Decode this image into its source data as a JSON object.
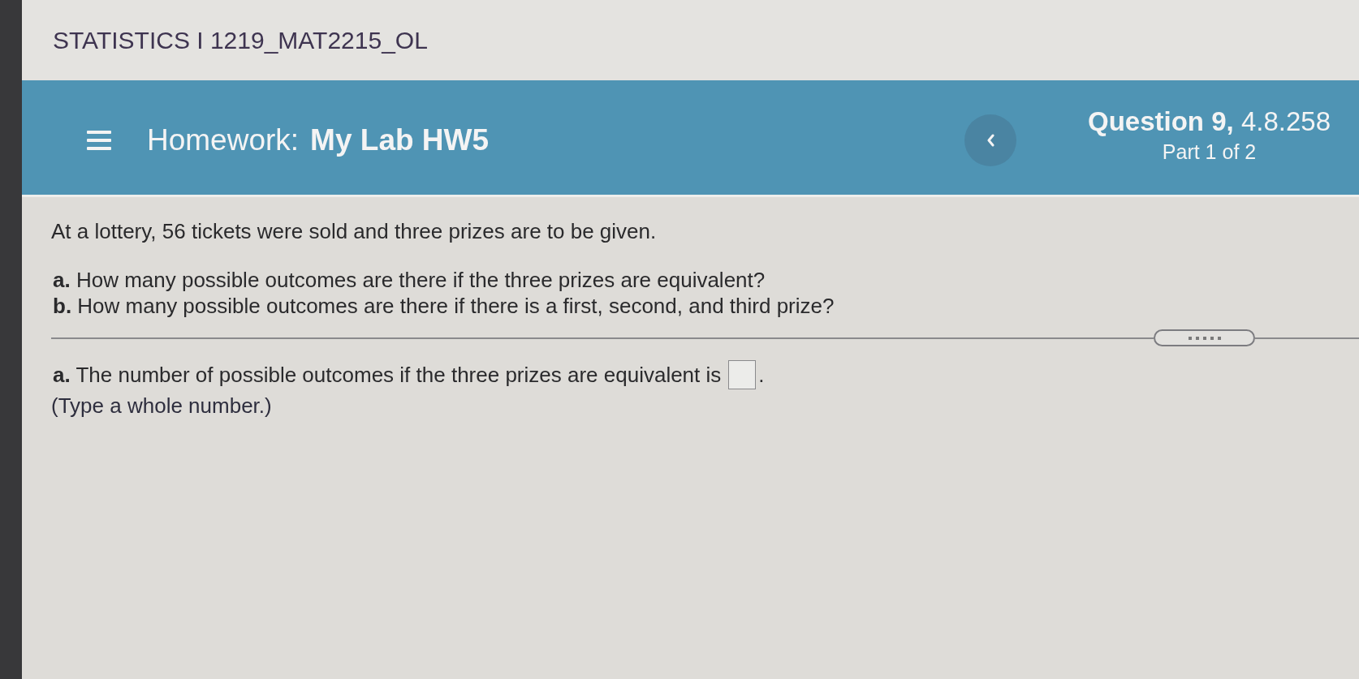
{
  "course_title": "STATISTICS I 1219_MAT2215_OL",
  "header": {
    "label": "Homework:",
    "name": "My Lab HW5",
    "question": "**Question 9,** 4.8.258",
    "part": "Part 1 of 2"
  },
  "question": {
    "intro": "At a lottery, 56 tickets were sold and three prizes are to be given.",
    "items": [
      "**a.** How many possible outcomes are there if the three prizes are equivalent?",
      "**b.** How many possible outcomes are there if there is a first, second, and third prize?"
    ]
  },
  "answer": {
    "prompt": "**a.** The number of possible outcomes if the three prizes are equivalent is",
    "after": ".",
    "hint": "(Type a whole number.)"
  }
}
